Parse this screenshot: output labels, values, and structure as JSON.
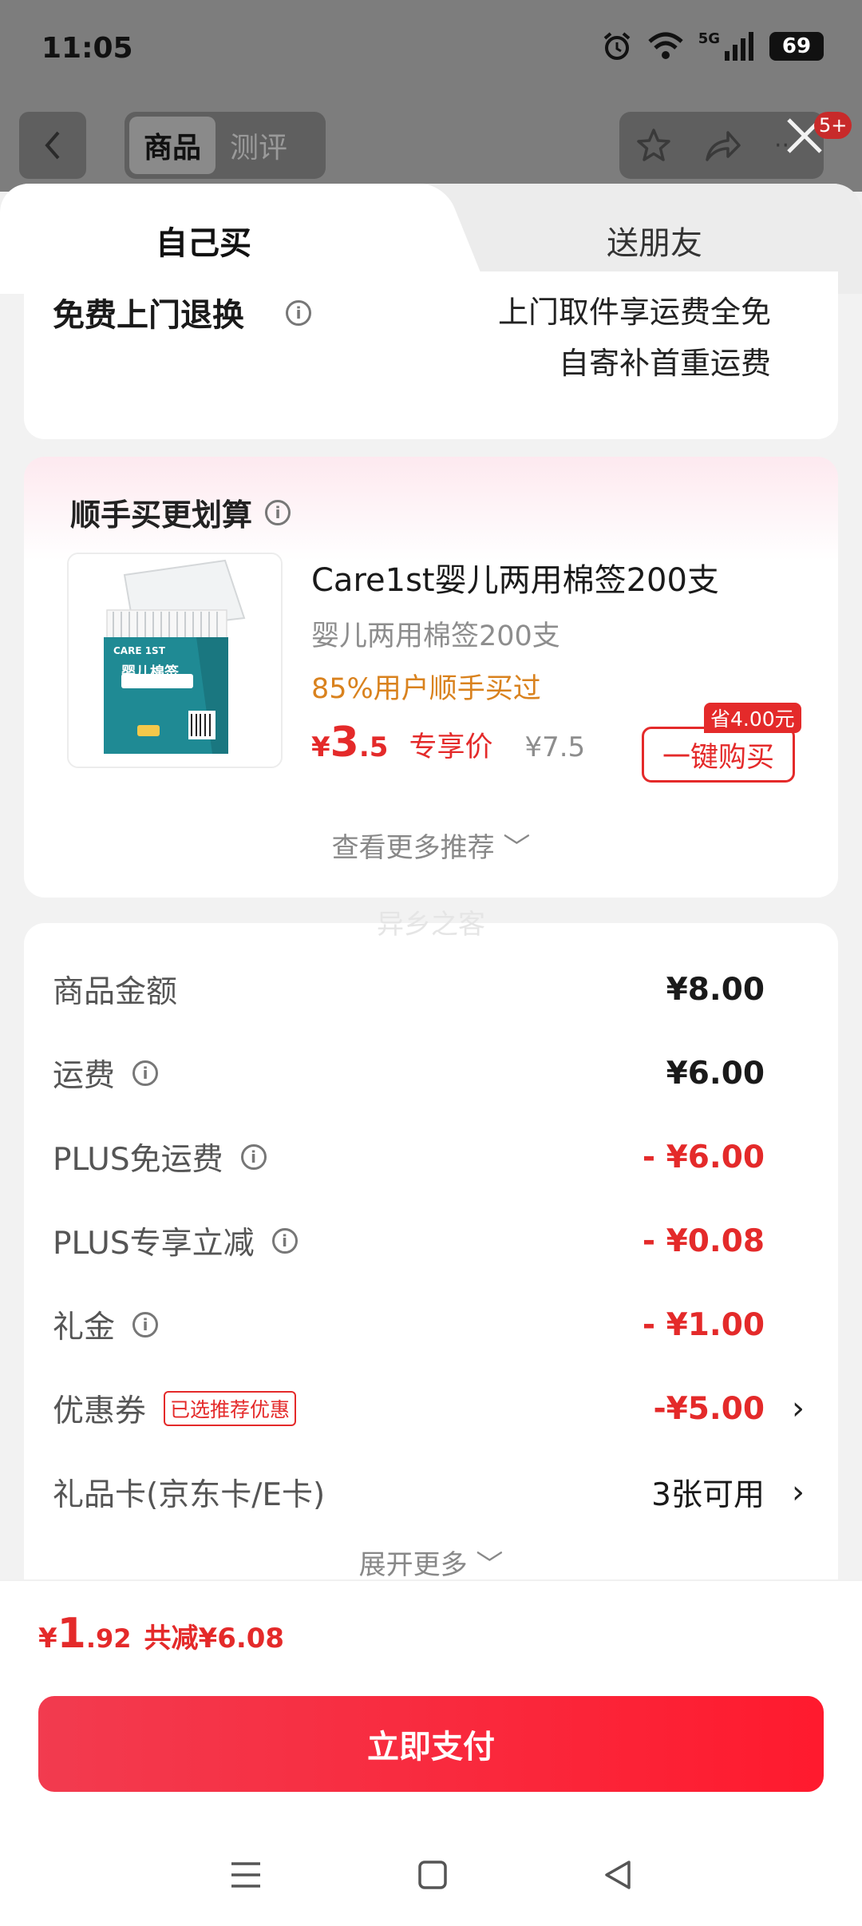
{
  "status_bar": {
    "time": "11:05",
    "network": "5G",
    "battery": "69"
  },
  "top_nav": {
    "tabs": [
      {
        "label": "商品",
        "active": true
      },
      {
        "label": "测评",
        "active": false
      }
    ],
    "badge": "5+"
  },
  "sheet_tabs": [
    {
      "label": "自己买",
      "active": true
    },
    {
      "label": "送朋友",
      "active": false
    }
  ],
  "return_service": {
    "title": "免费上门退换",
    "line1": "上门取件享运费全免",
    "line2": "自寄补首重运费"
  },
  "recommend": {
    "title": "顺手买更划算",
    "product": {
      "name": "Care1st婴儿两用棉签200支",
      "subtitle": "婴儿两用棉签200支",
      "stat": "85%用户顺手买过",
      "price_symbol": "¥",
      "price_int": "3",
      "price_dec": ".5",
      "price_tag": "专享价",
      "original_price": "¥7.5",
      "save_badge": "省4.00元",
      "buy_label": "一键购买",
      "image_brand": "CARE 1ST",
      "image_label": "婴儿棉签"
    },
    "see_more": "查看更多推荐"
  },
  "watermark": "异乡之客",
  "fees": {
    "rows": [
      {
        "label": "商品金额",
        "value": "¥8.00"
      },
      {
        "label": "运费",
        "value": "¥6.00"
      },
      {
        "label": "PLUS免运费",
        "value": "- ¥6.00"
      },
      {
        "label": "PLUS专享立减",
        "value": "- ¥0.08"
      },
      {
        "label": "礼金",
        "value": "- ¥1.00"
      },
      {
        "label": "优惠券",
        "badge": "已选推荐优惠",
        "value": "-¥5.00"
      },
      {
        "label": "礼品卡(京东卡/E卡)",
        "value": "3张可用"
      }
    ],
    "expand": "展开更多"
  },
  "total": {
    "symbol": "¥",
    "int": "1",
    "dec": ".92",
    "saved": "共减¥6.08"
  },
  "pay_button": "立即支付",
  "colors": {
    "accent": "#e42a2a",
    "pay_button": "#f23b4f",
    "stat_orange": "#d9821e"
  }
}
